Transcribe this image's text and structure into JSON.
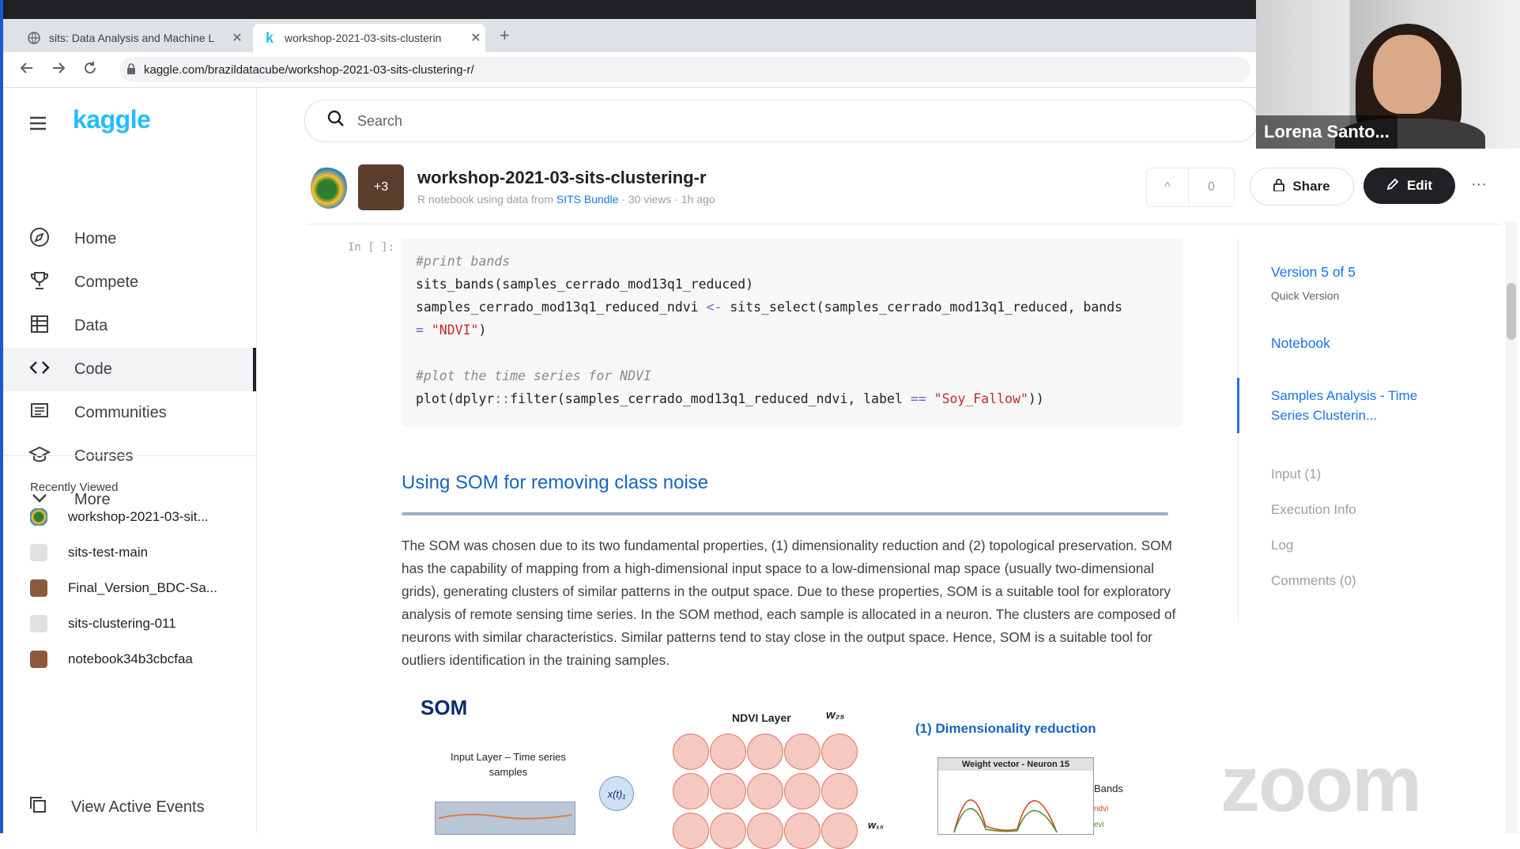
{
  "browser": {
    "tabs": [
      {
        "label": "sits: Data Analysis and Machine L",
        "close": "✕"
      },
      {
        "label": "workshop-2021-03-sits-clusterin",
        "close": "✕"
      }
    ],
    "new_tab": "+",
    "url": "kaggle.com/brazildatacube/workshop-2021-03-sits-clustering-r/"
  },
  "sidebar": {
    "logo": "kaggle",
    "nav": [
      {
        "label": "Home",
        "icon": "compass-icon"
      },
      {
        "label": "Compete",
        "icon": "trophy-icon"
      },
      {
        "label": "Data",
        "icon": "table-icon"
      },
      {
        "label": "Code",
        "icon": "code-icon"
      },
      {
        "label": "Communities",
        "icon": "comments-icon"
      },
      {
        "label": "Courses",
        "icon": "graduation-cap-icon"
      },
      {
        "label": "More",
        "icon": "chevron-down-icon"
      }
    ],
    "recently_viewed_title": "Recently Viewed",
    "recently_viewed": [
      {
        "label": "workshop-2021-03-sit..."
      },
      {
        "label": "sits-test-main"
      },
      {
        "label": "Final_Version_BDC-Sa..."
      },
      {
        "label": "sits-clustering-011"
      },
      {
        "label": "notebook34b3cbcfaa"
      }
    ],
    "view_active_events": "View Active Events"
  },
  "search": {
    "placeholder": "Search"
  },
  "notebook": {
    "collaborators_badge": "+3",
    "title": "workshop-2021-03-sits-clustering-r",
    "subtitle_prefix": "R notebook using data from",
    "subtitle_link": "SITS Bundle",
    "subtitle_suffix": "· 30 views · 1h ago",
    "vote_arrow": "^",
    "vote_count": "0",
    "share_label": "Share",
    "edit_label": "Edit",
    "more_label": "···"
  },
  "code_cell": {
    "prompt": "In [ ]:",
    "comment1": "#print bands",
    "line1": "sits_bands(samples_cerrado_mod13q1_reduced)",
    "line2a": "samples_cerrado_mod13q1_reduced_ndvi ",
    "line2op": "<-",
    "line2b": " sits_select(samples_cerrado_mod13q1_reduced, bands",
    "line3op": "=",
    "line3str": "\"NDVI\"",
    "line3end": ")",
    "comment2": "#plot the time series for NDVI",
    "line4a": "plot(dplyr",
    "line4op1": "::",
    "line4b": "filter(samples_cerrado_mod13q1_reduced_ndvi, label ",
    "line4op2": "==",
    "line4str": "\"Soy_Fallow\"",
    "line4end": "))"
  },
  "markdown": {
    "heading": "Using SOM for removing class noise",
    "paragraph": "The SOM was chosen due to its two fundamental properties, (1) dimensionality reduction and (2) topological preservation. SOM has the capability of mapping from a high-dimensional input space to a low-dimensional map space (usually two-dimensional grids), generating clusters of similar patterns in the output space. Due to these properties, SOM is a suitable tool for exploratory analysis of remote sensing time series. In the SOM method, each sample is allocated in a neuron. The clusters are composed of neurons with similar characteristics. Similar patterns tend to stay close in the output space. Hence, SOM is a suitable tool for outliers identification in the training samples."
  },
  "figure": {
    "title": "SOM",
    "input_layer_label": "Input Layer – Time series samples",
    "x_label": "x(t)₁",
    "ndvi_layer_label": "NDVI Layer",
    "w25": "w₂₅",
    "w15": "w₁₅",
    "dim_reduction": "(1) Dimensionality reduction",
    "weight_vector_title": "Weight vector - Neuron 15",
    "bands_label": "Bands",
    "band1": "ndvi",
    "band2": "evi"
  },
  "toc": {
    "version": "Version 5 of 5",
    "quick": "Quick Version",
    "notebook": "Notebook",
    "samples": "Samples Analysis - Time Series Clusterin...",
    "input": "Input (1)",
    "execution": "Execution Info",
    "log": "Log",
    "comments": "Comments (0)"
  },
  "video": {
    "name": "Lorena Santo..."
  },
  "watermark": "zoom",
  "colors": {
    "kaggle_blue": "#20beff",
    "link_blue": "#1a73e8",
    "edit_dark": "#202124"
  }
}
